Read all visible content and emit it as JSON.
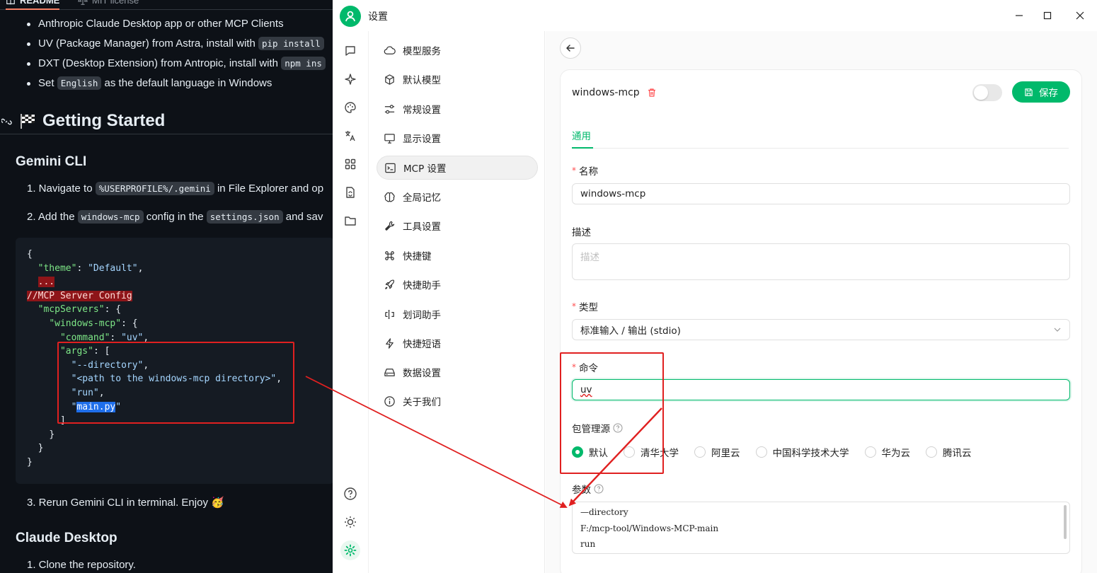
{
  "readme": {
    "tabs": [
      {
        "label": "README"
      },
      {
        "label": "MIT license"
      }
    ],
    "bullets": [
      {
        "text": "Anthropic Claude Desktop app or other MCP Clients"
      },
      {
        "pre": "UV (Package Manager) from Astra, install with",
        "code": "pip install"
      },
      {
        "pre": "DXT (Desktop Extension) from Antropic, install with",
        "code": "npm ins"
      },
      {
        "pre": "Set",
        "code": "English",
        "post": "as the default language in Windows"
      }
    ],
    "getting_started": "Getting Started",
    "gemini_heading": "Gemini CLI",
    "step1": {
      "pre": "1. Navigate to",
      "code": "%USERPROFILE%/.gemini",
      "post": "in File Explorer and op"
    },
    "step2": {
      "pre": "2. Add the",
      "code1": "windows-mcp",
      "mid": "config in the",
      "code2": "settings.json",
      "post": "and sav"
    },
    "code_lines": {
      "l1": "{",
      "l2_key": "\"theme\"",
      "l2_val": "\"Default\"",
      "l3": "...",
      "l4": "//MCP Server Config",
      "l5_key": "\"mcpServers\"",
      "l6_key": "\"windows-mcp\"",
      "l7_key": "\"command\"",
      "l7_val": "\"uv\"",
      "l8_key": "\"args\"",
      "l9": "\"--directory\"",
      "l10": "\"<path to the windows-mcp directory>\"",
      "l11": "\"run\"",
      "l12_sel": "main.py",
      "close1": "]",
      "close2": "}",
      "close3": "}",
      "close4": "}"
    },
    "step3": {
      "text": "3. Rerun Gemini CLI in terminal. Enjoy",
      "emoji": "🥳"
    },
    "claude_heading": "Claude Desktop",
    "step_clone": "1. Clone the repository."
  },
  "window": {
    "title": "设置",
    "menu": [
      {
        "label": "模型服务",
        "icon": "cloud-icon"
      },
      {
        "label": "默认模型",
        "icon": "cube-icon"
      },
      {
        "label": "常规设置",
        "icon": "sliders-icon"
      },
      {
        "label": "显示设置",
        "icon": "monitor-icon"
      },
      {
        "label": "MCP 设置",
        "icon": "terminal-icon",
        "active": true
      },
      {
        "label": "全局记忆",
        "icon": "brain-icon"
      },
      {
        "label": "工具设置",
        "icon": "tools-icon"
      },
      {
        "label": "快捷键",
        "icon": "command-icon"
      },
      {
        "label": "快捷助手",
        "icon": "rocket-icon"
      },
      {
        "label": "划词助手",
        "icon": "text-cursor-icon"
      },
      {
        "label": "快捷短语",
        "icon": "zap-icon"
      },
      {
        "label": "数据设置",
        "icon": "hard-drive-icon"
      },
      {
        "label": "关于我们",
        "icon": "info-icon"
      }
    ],
    "server": {
      "name": "windows-mcp",
      "save_label": "保存",
      "tab_general": "通用",
      "name_label": "名称",
      "name_value": "windows-mcp",
      "desc_label": "描述",
      "desc_placeholder": "描述",
      "type_label": "类型",
      "type_value": "标准输入 / 输出 (stdio)",
      "command_label": "命令",
      "command_value": "uv",
      "pkg_label": "包管理源",
      "pkg_options": [
        "默认",
        "清华大学",
        "阿里云",
        "中国科学技术大学",
        "华为云",
        "腾讯云"
      ],
      "pkg_selected": "默认",
      "args_label": "参数",
      "args_lines": [
        "—directory",
        "F:/mcp-tool/Windows-MCP-main",
        "run"
      ]
    }
  },
  "colors": {
    "accent": "#00b96b",
    "annotation": "#e02020",
    "gh_bg": "#0d1117"
  }
}
